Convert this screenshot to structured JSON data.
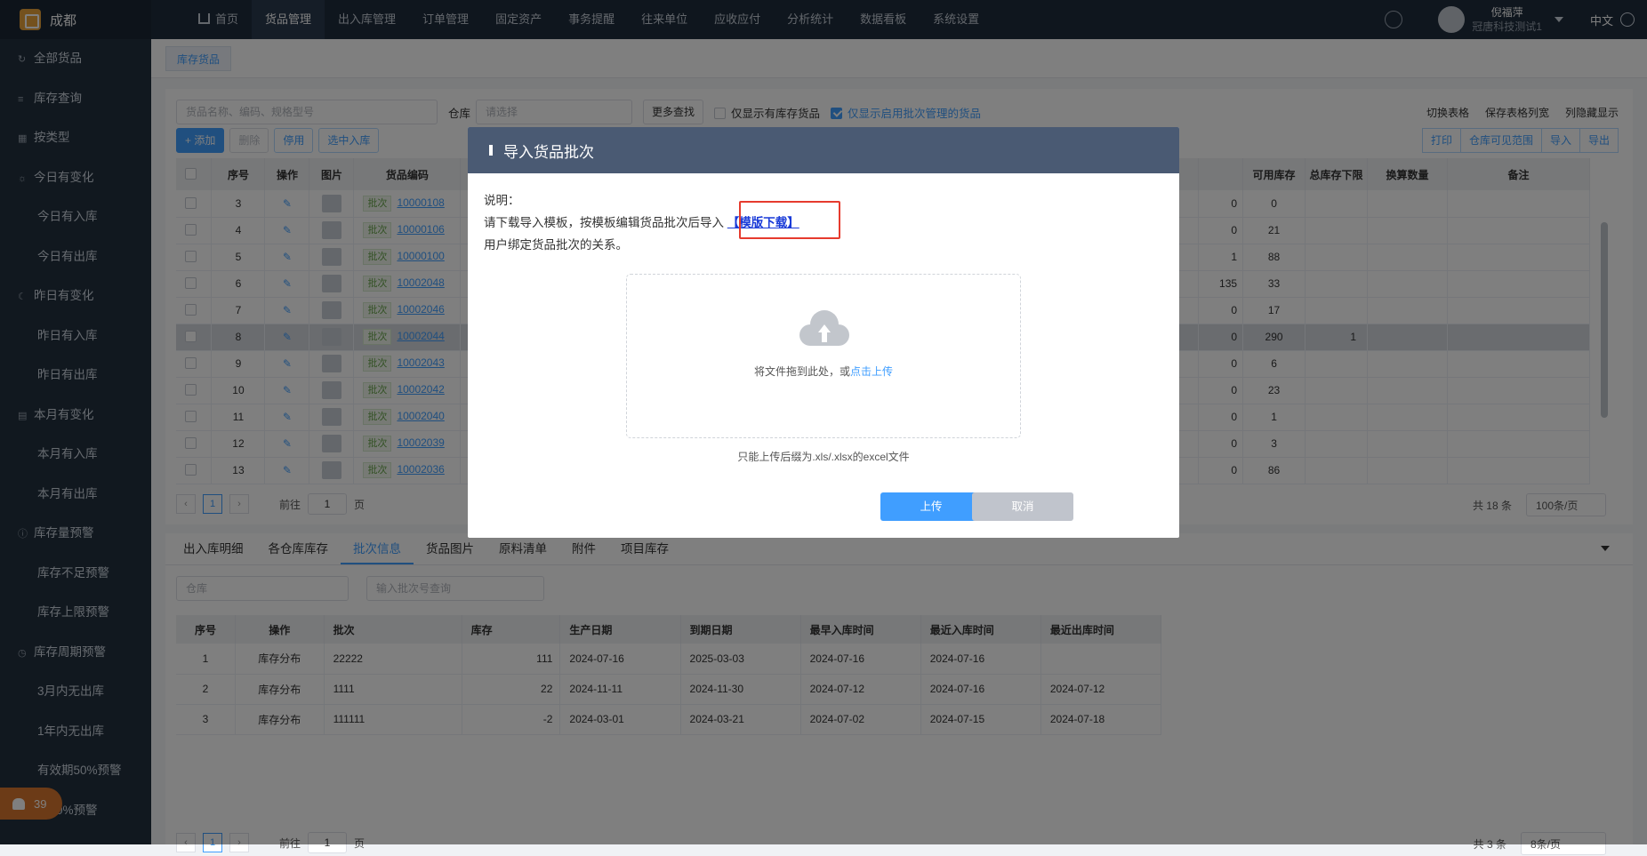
{
  "header": {
    "company": "成都",
    "nav": [
      "首页",
      "货品管理",
      "出入库管理",
      "订单管理",
      "固定资产",
      "事务提醒",
      "往来单位",
      "应收应付",
      "分析统计",
      "数据看板",
      "系统设置"
    ],
    "active_nav": "货品管理",
    "user_name": "倪福萍",
    "user_company": "冠唐科技测试1",
    "lang": "中文"
  },
  "sidebar": {
    "items": [
      {
        "label": "全部货品",
        "icon": "refresh-icon",
        "child": false
      },
      {
        "label": "库存查询",
        "icon": "list-icon",
        "child": false
      },
      {
        "label": "按类型",
        "icon": "grid-icon",
        "child": false
      },
      {
        "label": "今日有变化",
        "icon": "sun-icon",
        "child": false
      },
      {
        "label": "今日有入库",
        "icon": "",
        "child": true
      },
      {
        "label": "今日有出库",
        "icon": "",
        "child": true
      },
      {
        "label": "昨日有变化",
        "icon": "moon-icon",
        "child": false
      },
      {
        "label": "昨日有入库",
        "icon": "",
        "child": true
      },
      {
        "label": "昨日有出库",
        "icon": "",
        "child": true
      },
      {
        "label": "本月有变化",
        "icon": "calendar-icon",
        "child": false
      },
      {
        "label": "本月有入库",
        "icon": "",
        "child": true
      },
      {
        "label": "本月有出库",
        "icon": "",
        "child": true
      },
      {
        "label": "库存量预警",
        "icon": "info-icon",
        "child": false
      },
      {
        "label": "库存不足预警",
        "icon": "",
        "child": true
      },
      {
        "label": "库存上限预警",
        "icon": "",
        "child": true
      },
      {
        "label": "库存周期预警",
        "icon": "clock-icon",
        "child": false
      },
      {
        "label": "3月内无出库",
        "icon": "",
        "child": true
      },
      {
        "label": "1年内无出库",
        "icon": "",
        "child": true
      },
      {
        "label": "有效期50%预警",
        "icon": "",
        "child": true
      },
      {
        "label": "期80%预警",
        "icon": "",
        "child": true
      }
    ],
    "alarm_count": "39"
  },
  "page_tab": "库存货品",
  "toolbar": {
    "search_placeholder": "货品名称、编码、规格型号",
    "warehouse_label": "仓库",
    "warehouse_placeholder": "请选择",
    "more_search": "更多查找",
    "only_stock": "仅显示有库存货品",
    "only_batch": "仅显示启用批次管理的货品",
    "switch_table": "切换表格",
    "save_cols": "保存表格列宽",
    "hide_cols": "列隐藏显示",
    "add": "+ 添加",
    "delete": "删除",
    "disable": "停用",
    "select_in": "选中入库",
    "print": "打印",
    "visible_range": "仓库可见范围",
    "import": "导入",
    "export": "导出"
  },
  "grid": {
    "headers_left": [
      "序号",
      "操作",
      "图片",
      "货品编码"
    ],
    "headers_right": [
      "可用库存",
      "总库存下限",
      "换算数量",
      "备注"
    ],
    "batch_tag": "批次",
    "rows": [
      {
        "no": "3",
        "code": "10000108",
        "a": "0",
        "b": "0",
        "c": ""
      },
      {
        "no": "4",
        "code": "10000106",
        "a": "0",
        "b": "21",
        "c": ""
      },
      {
        "no": "5",
        "code": "10000100",
        "a": "1",
        "b": "88",
        "c": ""
      },
      {
        "no": "6",
        "code": "10002048",
        "a": "135",
        "b": "33",
        "c": ""
      },
      {
        "no": "7",
        "code": "10002046",
        "a": "0",
        "b": "17",
        "c": ""
      },
      {
        "no": "8",
        "code": "10002044",
        "a": "0",
        "b": "290",
        "c": "1"
      },
      {
        "no": "9",
        "code": "10002043",
        "a": "0",
        "b": "6",
        "c": ""
      },
      {
        "no": "10",
        "code": "10002042",
        "a": "0",
        "b": "23",
        "c": ""
      },
      {
        "no": "11",
        "code": "10002040",
        "a": "0",
        "b": "1",
        "c": ""
      },
      {
        "no": "12",
        "code": "10002039",
        "a": "0",
        "b": "3",
        "c": ""
      },
      {
        "no": "13",
        "code": "10002036",
        "a": "0",
        "b": "86",
        "c": ""
      }
    ],
    "pager_goto": "前往",
    "pager_page": "1",
    "pager_unit": "页",
    "total": "共 18 条",
    "page_size": "100条/页"
  },
  "bottom": {
    "tabs": [
      "出入库明细",
      "各仓库库存",
      "批次信息",
      "货品图片",
      "原料清单",
      "附件",
      "项目库存"
    ],
    "active_tab": "批次信息",
    "warehouse_placeholder": "仓库",
    "batch_placeholder": "输入批次号查询",
    "headers": [
      "序号",
      "操作",
      "批次",
      "库存",
      "生产日期",
      "到期日期",
      "最早入库时间",
      "最近入库时间",
      "最近出库时间"
    ],
    "rows": [
      {
        "no": "1",
        "op": "库存分布",
        "batch": "22222",
        "stock": "111",
        "mfg": "2024-07-16",
        "exp": "2025-03-03",
        "first_in": "2024-07-16",
        "last_in": "2024-07-16",
        "last_out": ""
      },
      {
        "no": "2",
        "op": "库存分布",
        "batch": "1111",
        "stock": "22",
        "mfg": "2024-11-11",
        "exp": "2024-11-30",
        "first_in": "2024-07-12",
        "last_in": "2024-07-16",
        "last_out": "2024-07-12"
      },
      {
        "no": "3",
        "op": "库存分布",
        "batch": "111111",
        "stock": "-2",
        "mfg": "2024-03-01",
        "exp": "2024-03-21",
        "first_in": "2024-07-02",
        "last_in": "2024-07-15",
        "last_out": "2024-07-18"
      }
    ],
    "pager_goto": "前往",
    "pager_page": "1",
    "pager_unit": "页",
    "total": "共 3 条",
    "page_size": "8条/页"
  },
  "dialog": {
    "title": "导入货品批次",
    "note_label": "说明：",
    "line1": "请下载导入模板，按模板编辑货品批次后导入",
    "download_link": "【模版下载】",
    "line2": "用户绑定货品批次的关系。",
    "drop_text": "将文件拖到此处，或",
    "drop_link": "点击上传",
    "tip": "只能上传后缀为.xls/.xlsx的excel文件",
    "upload": "上传",
    "cancel": "取消",
    "colors": {
      "upload": "#409eff",
      "cancel": "#c0c4cc",
      "highlight": "#e63b2e"
    }
  }
}
